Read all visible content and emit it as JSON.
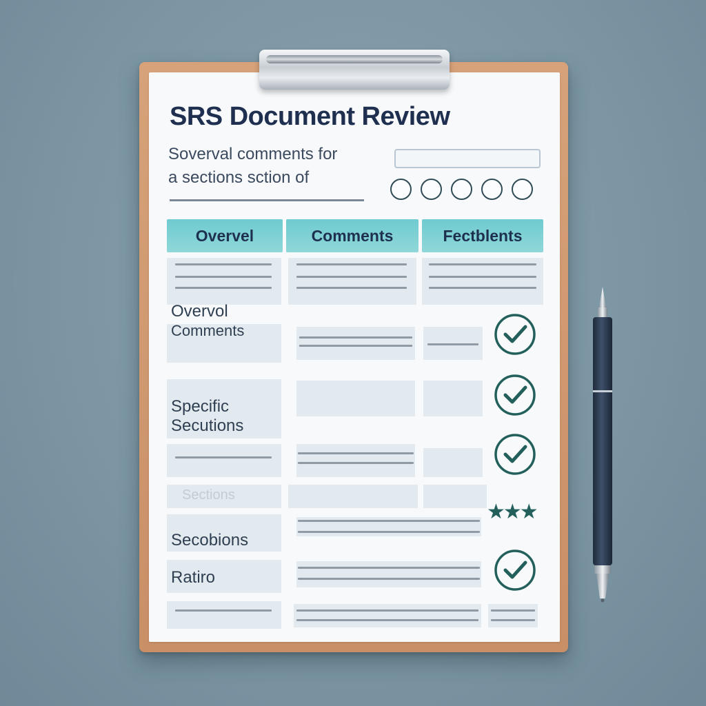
{
  "document": {
    "title": "SRS Document Review",
    "subtitle_line1": "Soverval comments for",
    "subtitle_line2": "a sections sction of",
    "rating_circle_count": 5
  },
  "table": {
    "columns": [
      "Overvel",
      "Comments",
      "Fectblents"
    ],
    "rows": [
      {
        "label_line1": "Overvol",
        "label_line2": "Comments",
        "status": "check"
      },
      {
        "label_line1": "Specific",
        "label_line2": "Secutions",
        "status": "check"
      },
      {
        "label_line1": "",
        "label_line2": "",
        "status": "check"
      },
      {
        "label_line1": "Sections",
        "label_line2": "",
        "status": "none"
      },
      {
        "label_line1": "",
        "label_line2": "",
        "status": "stars",
        "stars": "★★★"
      },
      {
        "label_line1": "Secobions",
        "label_line2": "",
        "status": "none"
      },
      {
        "label_line1": "Ratiro",
        "label_line2": "",
        "status": "check"
      }
    ]
  },
  "colors": {
    "header_fill": "#7fd0d3",
    "title_text": "#1f2f4f",
    "check_color": "#23605c",
    "board": "#d29b72",
    "pen": "#2b3a4f"
  },
  "icons": [
    "clipboard-clip-icon",
    "checkmark-circle-icon",
    "star-icon",
    "pen-icon"
  ]
}
